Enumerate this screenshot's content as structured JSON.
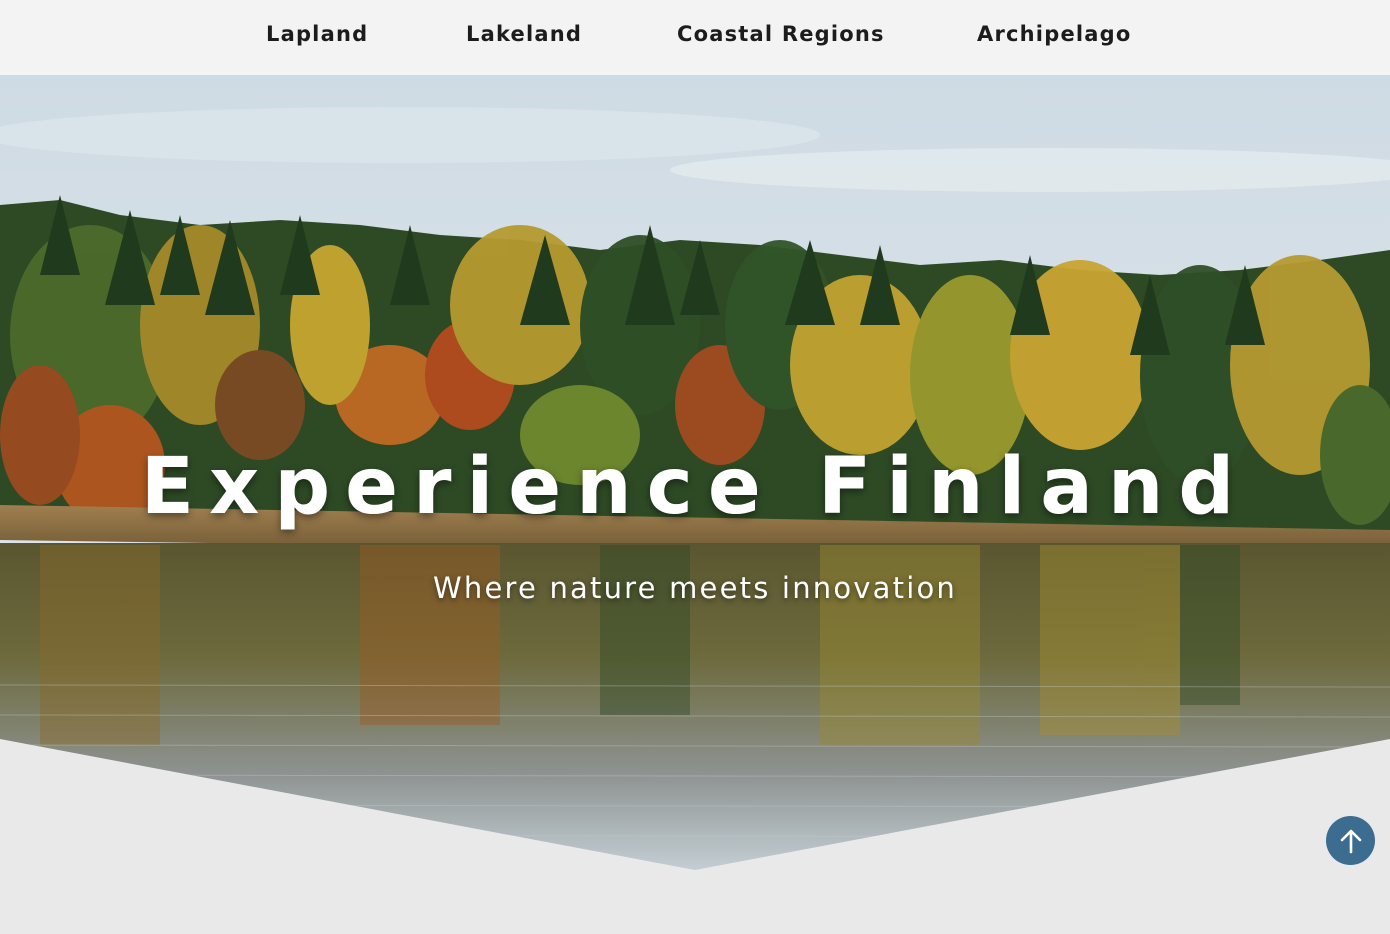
{
  "nav": {
    "items": [
      {
        "label": "Lapland"
      },
      {
        "label": "Lakeland"
      },
      {
        "label": "Coastal Regions"
      },
      {
        "label": "Archipelago"
      }
    ]
  },
  "hero": {
    "title": "Experience Finland",
    "subtitle": "Where nature meets innovation"
  },
  "back_to_top": {
    "icon": "arrow-up-icon"
  },
  "colors": {
    "nav_background": "#f3f3f3",
    "page_background": "#e9e9e9",
    "button_accent": "#3c6d91",
    "text_dark": "#1c1c1c"
  }
}
